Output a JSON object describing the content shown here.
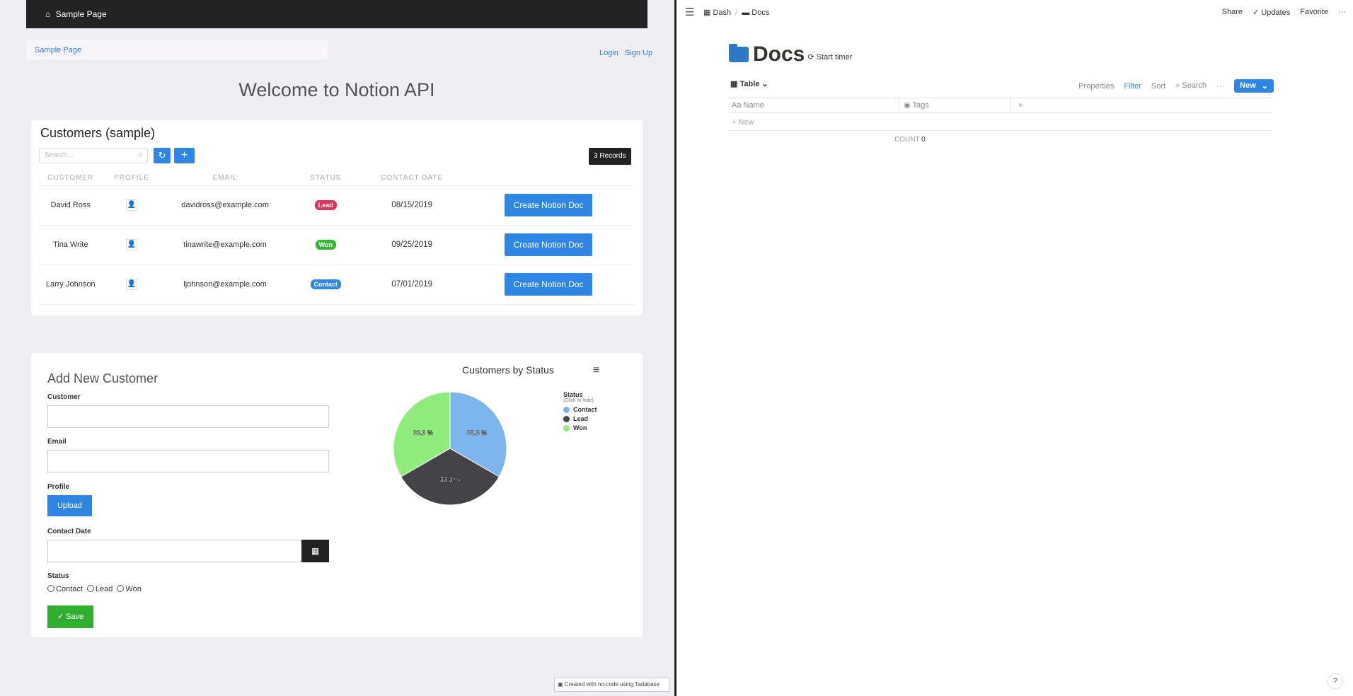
{
  "left": {
    "topbar": {
      "home_label": "Sample Page"
    },
    "breadcrumb": "Sample Page",
    "auth": {
      "login": "Login",
      "signup": "Sign Up"
    },
    "welcome": "Welcome to Notion API",
    "customers": {
      "title": "Customers (sample)",
      "search_placeholder": "Search...",
      "records": "3 Records",
      "columns": [
        "CUSTOMER",
        "PROFILE",
        "EMAIL",
        "STATUS",
        "CONTACT DATE"
      ],
      "rows": [
        {
          "name": "David Ross",
          "email": "davidross@example.com",
          "status": "Lead",
          "status_color": "#e0335a",
          "date": "08/15/2019",
          "action": "Create Notion Doc"
        },
        {
          "name": "Tina Write",
          "email": "tinawrite@example.com",
          "status": "Won",
          "status_color": "#35b635",
          "date": "09/25/2019",
          "action": "Create Notion Doc"
        },
        {
          "name": "Larry Johnson",
          "email": "ljohnson@example.com",
          "status": "Contact",
          "status_color": "#2f86e5",
          "date": "07/01/2019",
          "action": "Create Notion Doc"
        }
      ]
    },
    "form": {
      "title": "Add New Customer",
      "customer_label": "Customer",
      "email_label": "Email",
      "profile_label": "Profile",
      "upload_label": "Upload",
      "date_label": "Contact Date",
      "status_label": "Status",
      "status_options": [
        "Contact",
        "Lead",
        "Won"
      ],
      "save_label": "Save"
    },
    "chart_data": {
      "type": "pie",
      "title": "Customers by Status",
      "legend_title": "Status",
      "legend_subtitle": "(Click to hide)",
      "legend_position": "right",
      "categories": [
        "Contact",
        "Lead",
        "Won"
      ],
      "values": [
        33.3,
        33.3,
        33.3
      ],
      "labels": [
        "33.3 %",
        "33.3 %",
        "33.3 %"
      ],
      "colors": [
        "#7cb5ec",
        "#434348",
        "#90ed7d"
      ]
    },
    "footer_badge": "Created with no-code using Tadabase"
  },
  "notion": {
    "breadcrumb": [
      "Dash",
      "Docs"
    ],
    "top_actions": [
      "Share",
      "Updates",
      "Favorite",
      "···"
    ],
    "page_title": "Docs",
    "start_timer": "Start timer",
    "view_label": "Table",
    "view_actions": [
      "Properties",
      "Filter",
      "Sort",
      "Search",
      "···"
    ],
    "new_label": "New",
    "columns": [
      "Name",
      "Tags"
    ],
    "new_row_label": "New",
    "count_label": "COUNT",
    "count_value": "0",
    "help": "?"
  }
}
